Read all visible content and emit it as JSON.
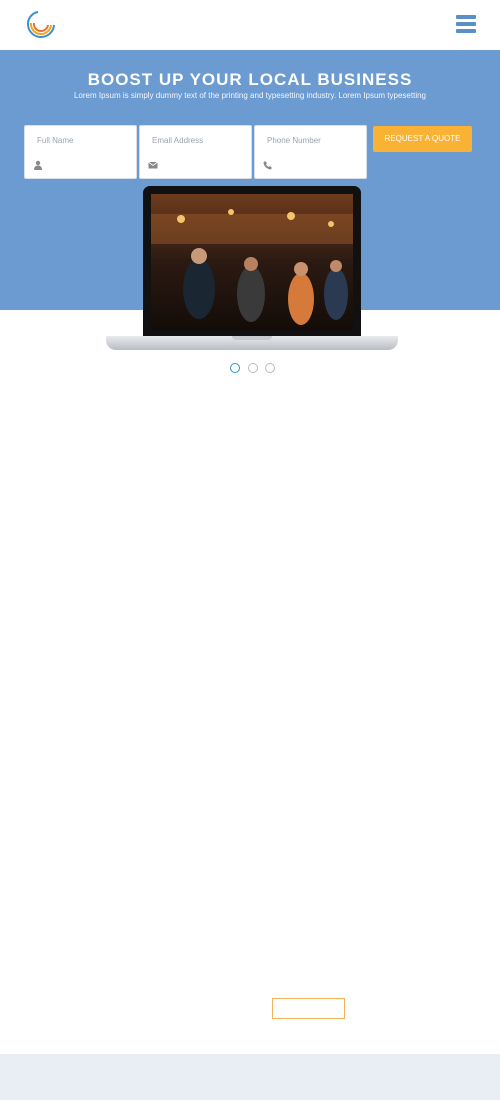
{
  "header": {
    "logo_icon": "swirl-logo-icon",
    "menu_icon": "hamburger-menu-icon",
    "colors": {
      "logo_orange": "#f4a51c",
      "logo_blue": "#3b8fd4",
      "menu": "#5b8fc7"
    }
  },
  "hero": {
    "title": "BOOST UP YOUR LOCAL BUSINESS",
    "subtitle": "Lorem Ipsum is simply dummy text of the printing and typesetting industry. Lorem Ipsum typesetting",
    "background": "#6b9bd0",
    "form": {
      "fields": [
        {
          "label": "Full Name",
          "icon": "user-icon"
        },
        {
          "label": "Email Address",
          "icon": "envelope-icon"
        },
        {
          "label": "Phone Number",
          "icon": "phone-icon"
        }
      ],
      "submit_label": "REQUEST A QUOTE",
      "accent": "#f9b233"
    },
    "showcase_image": "laptop-with-bar-photo"
  },
  "slider": {
    "slide_count": 3,
    "active_index": 0,
    "active_color": "#2d94c8"
  },
  "lower": {
    "outline_button_label": "",
    "outline_color": "#f3b25a",
    "footer_band_color": "#e9eef5"
  }
}
